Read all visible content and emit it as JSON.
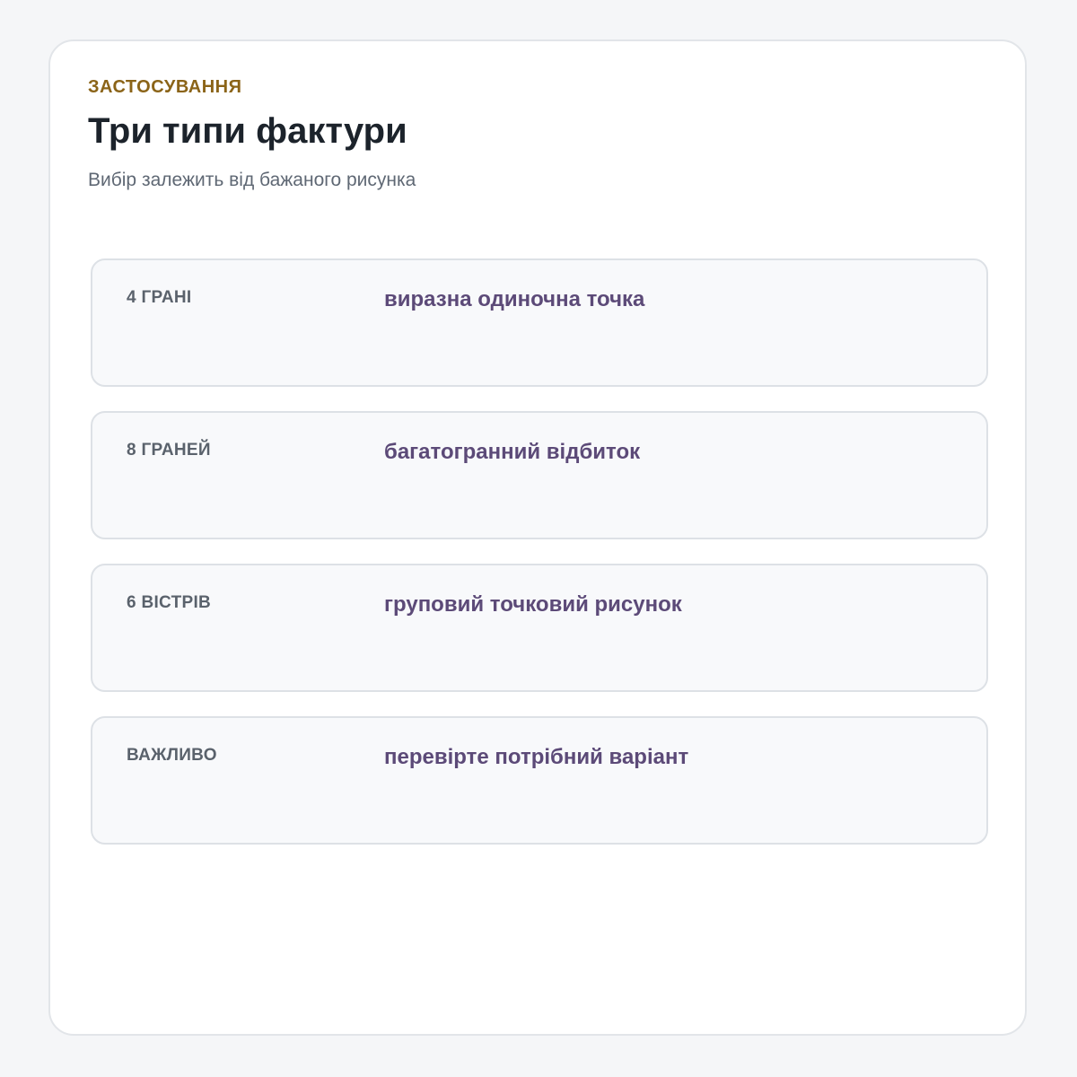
{
  "header": {
    "eyebrow": "ЗАСТОСУВАННЯ",
    "title": "Три типи фактури",
    "subtitle": "Вибір залежить від бажаного рисунка"
  },
  "rows": [
    {
      "label": "4 ГРАНІ",
      "value": "виразна одиночна точка"
    },
    {
      "label": "8 ГРАНЕЙ",
      "value": "багатогранний відбиток"
    },
    {
      "label": "6 ВІСТРІВ",
      "value": "груповий точковий рисунок"
    },
    {
      "label": "ВАЖЛИВО",
      "value": "перевірте потрібний варіант"
    }
  ],
  "colors": {
    "accent": "#8b6418",
    "value_text": "#5c4a78",
    "title_text": "#1c232b"
  }
}
